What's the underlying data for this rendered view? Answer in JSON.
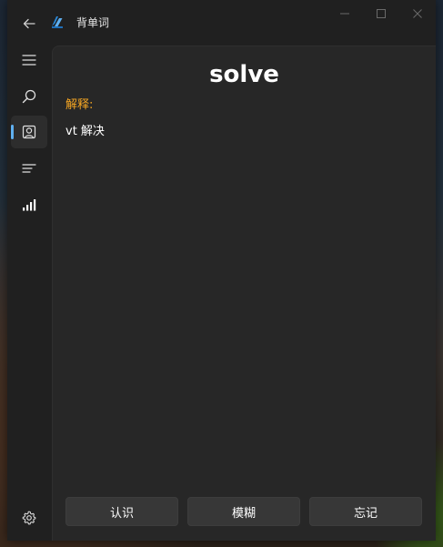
{
  "app": {
    "title": "背单词",
    "icons": {
      "back": "back-arrow-icon",
      "app": "app-logo-icon",
      "minimize": "minimize-icon",
      "maximize": "maximize-icon",
      "close": "close-icon"
    }
  },
  "nav": {
    "items": [
      {
        "id": "menu",
        "icon": "hamburger-menu-icon"
      },
      {
        "id": "search",
        "icon": "search-icon"
      },
      {
        "id": "recite",
        "icon": "contact-card-icon",
        "selected": true
      },
      {
        "id": "list",
        "icon": "list-icon"
      },
      {
        "id": "stats",
        "icon": "signal-bars-icon"
      }
    ],
    "settings_icon": "gear-icon"
  },
  "card": {
    "word": "solve",
    "definition_label": "解释:",
    "definition": "vt 解决"
  },
  "actions": {
    "know_label": "认识",
    "fuzzy_label": "模糊",
    "forget_label": "忘记"
  },
  "colors": {
    "accent": "#60b0f0",
    "definition_label": "#f5a623",
    "window_bg": "#202020",
    "content_bg": "#272727",
    "button_bg": "#373737"
  }
}
